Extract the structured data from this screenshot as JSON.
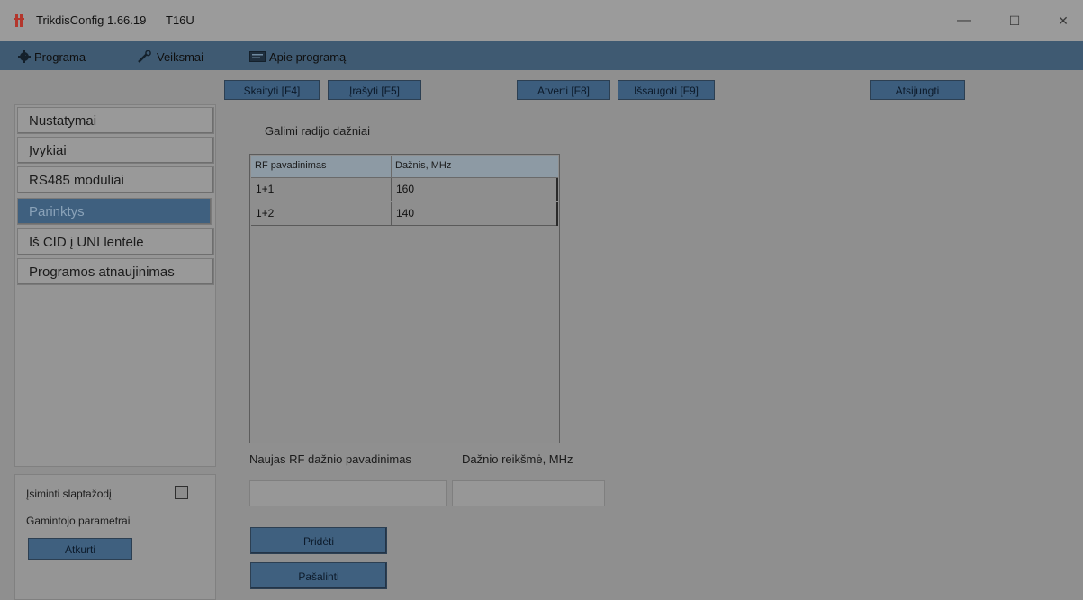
{
  "window": {
    "title": "TrikdisConfig 1.66.19",
    "model": "T16U",
    "minimize_glyph": "—",
    "maximize_glyph": "☐",
    "close_glyph": "✕",
    "icon": "app-logo-icon"
  },
  "menu": {
    "items": [
      {
        "label": "Programa",
        "icon": "gear-icon"
      },
      {
        "label": "Veiksmai",
        "icon": "wrench-icon"
      },
      {
        "label": "Apie programą",
        "icon": "info-card-icon"
      }
    ]
  },
  "toolbar": {
    "read": "Skaityti [F4]",
    "write": "Įrašyti [F5]",
    "open": "Atverti [F8]",
    "save": "Išsaugoti [F9]",
    "disconnect": "Atsijungti"
  },
  "sidebar": {
    "items": [
      {
        "label": "Nustatymai",
        "active": false
      },
      {
        "label": "Įvykiai",
        "active": false
      },
      {
        "label": "RS485 moduliai",
        "active": false
      },
      {
        "label": "Parinktys",
        "active": true
      },
      {
        "label": "Iš CID į UNI lentelė",
        "active": false
      },
      {
        "label": "Programos atnaujinimas",
        "active": false
      }
    ]
  },
  "bottom_panel": {
    "remember_password": "Įsiminti slaptažodį",
    "remember_checked": false,
    "factory_params": "Gamintojo parametrai",
    "restore_button": "Atkurti"
  },
  "main": {
    "section_title": "Galimi radijo dažniai",
    "table": {
      "columns": [
        "RF pavadinimas",
        "Dažnis, MHz"
      ],
      "rows": [
        [
          "1+1",
          "160"
        ],
        [
          "1+2",
          "140"
        ]
      ]
    },
    "new_name_label": "Naujas RF dažnio pavadinimas",
    "new_name_value": "",
    "freq_value_label": "Dažnio reikšmė, MHz",
    "freq_value": "",
    "add_button": "Pridėti",
    "remove_button": "Pašalinti"
  },
  "colors": {
    "accent": "#3f607f",
    "menubar": "#3f5a72",
    "background": "#8f8f8f"
  }
}
